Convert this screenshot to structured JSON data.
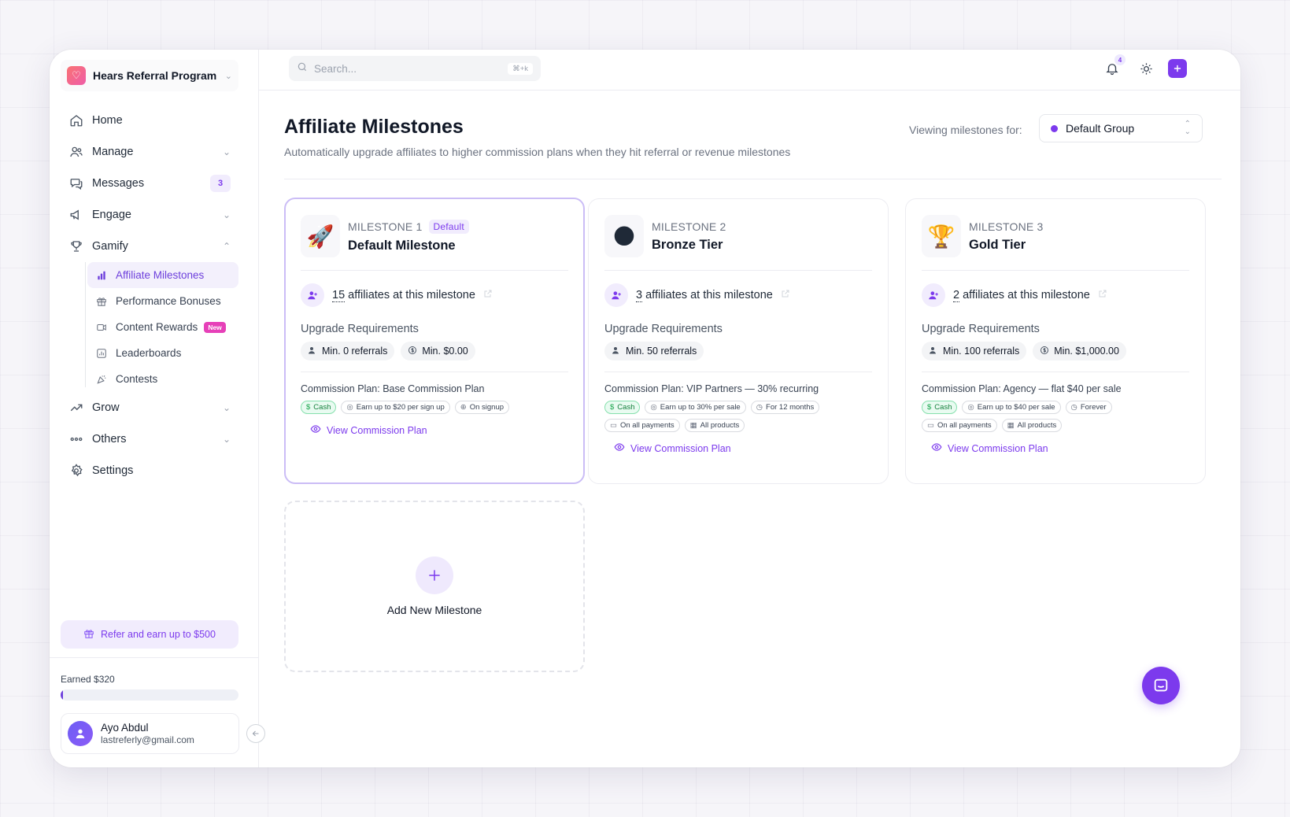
{
  "workspace": {
    "name": "Hears Referral Program"
  },
  "nav": {
    "home": "Home",
    "manage": "Manage",
    "messages": "Messages",
    "messages_count": "3",
    "engage": "Engage",
    "gamify": "Gamify",
    "gamify_items": {
      "affiliate_milestones": "Affiliate Milestones",
      "performance_bonuses": "Performance Bonuses",
      "content_rewards": "Content Rewards",
      "content_rewards_badge": "New",
      "leaderboards": "Leaderboards",
      "contests": "Contests"
    },
    "grow": "Grow",
    "others": "Others",
    "settings": "Settings"
  },
  "refer": {
    "label": "Refer and earn up to $500"
  },
  "earnings": {
    "label": "Earned $320",
    "progress": 0.01
  },
  "user": {
    "name": "Ayo Abdul",
    "email": "lastreferly@gmail.com"
  },
  "topbar": {
    "search_placeholder": "Search...",
    "shortcut": "⌘+k",
    "notifications_count": "4"
  },
  "page": {
    "title": "Affiliate Milestones",
    "subtitle": "Automatically upgrade affiliates to higher commission plans when they hit referral or revenue milestones",
    "viewing_label": "Viewing milestones for:",
    "group": "Default Group"
  },
  "milestones": [
    {
      "label": "MILESTONE 1",
      "tag": "Default",
      "name": "Default Milestone",
      "emoji": "🚀",
      "count": "15",
      "count_suffix": "affiliates at this milestone",
      "req_title": "Upgrade Requirements",
      "reqs": [
        "Min. 0 referrals",
        "Min. $0.00"
      ],
      "plan": "Commission Plan: Base Commission Plan",
      "tags": [
        "Cash",
        "Earn up to $20 per sign up",
        "On signup"
      ],
      "view": "View Commission Plan"
    },
    {
      "label": "MILESTONE 2",
      "name": "Bronze Tier",
      "emoji": "🌑",
      "count": "3",
      "count_suffix": "affiliates at this milestone",
      "req_title": "Upgrade Requirements",
      "reqs": [
        "Min. 50 referrals"
      ],
      "plan": "Commission Plan: VIP Partners — 30% recurring",
      "tags": [
        "Cash",
        "Earn up to 30% per sale",
        "For 12 months",
        "On all payments",
        "All products"
      ],
      "view": "View Commission Plan"
    },
    {
      "label": "MILESTONE 3",
      "name": "Gold Tier",
      "emoji": "🏆",
      "count": "2",
      "count_suffix": "affiliates at this milestone",
      "req_title": "Upgrade Requirements",
      "reqs": [
        "Min. 100 referrals",
        "Min. $1,000.00"
      ],
      "plan": "Commission Plan: Agency — flat $40 per sale",
      "tags": [
        "Cash",
        "Earn up to $40 per sale",
        "Forever",
        "On all payments",
        "All products"
      ],
      "view": "View Commission Plan"
    }
  ],
  "add_milestone": {
    "label": "Add New Milestone"
  },
  "colors": {
    "accent": "#7c3aed",
    "accent_soft": "#f1ecfd",
    "cash_green": "#16a34a"
  }
}
